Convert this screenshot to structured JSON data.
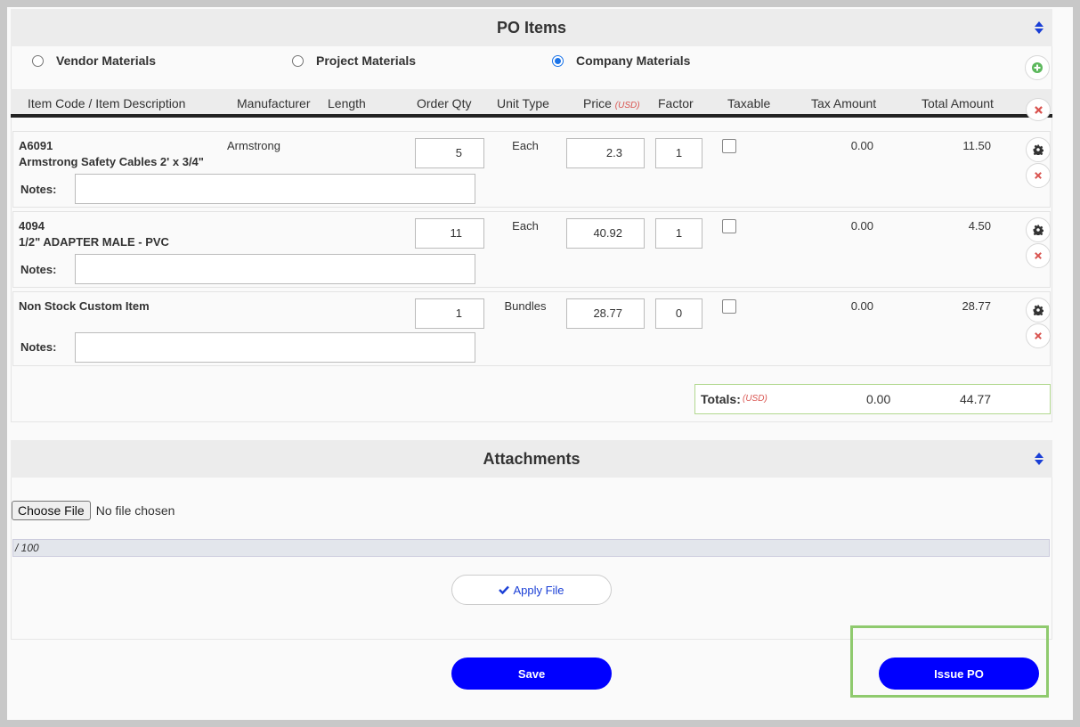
{
  "po_items": {
    "title": "PO Items",
    "radio_options": [
      {
        "label": "Vendor Materials",
        "checked": false
      },
      {
        "label": "Project Materials",
        "checked": false
      },
      {
        "label": "Company Materials",
        "checked": true
      }
    ],
    "columns": {
      "item": "Item Code / Item Description",
      "manufacturer": "Manufacturer",
      "length": "Length",
      "order_qty": "Order Qty",
      "unit_type": "Unit Type",
      "price": "Price",
      "price_currency": "(USD)",
      "factor": "Factor",
      "taxable": "Taxable",
      "tax_amount": "Tax Amount",
      "total_amount": "Total Amount"
    },
    "rows": [
      {
        "code": "A6091",
        "description": "Armstrong Safety Cables 2' x 3/4\"",
        "manufacturer": "Armstrong",
        "qty": "5",
        "unit": "Each",
        "price": "2.3",
        "factor": "1",
        "taxable": false,
        "tax_amount": "0.00",
        "total_amount": "11.50",
        "notes_label": "Notes:",
        "notes": ""
      },
      {
        "code": "4094",
        "description": "1/2\" ADAPTER MALE - PVC",
        "manufacturer": "",
        "qty": "11",
        "unit": "Each",
        "price": "40.92",
        "factor": "1",
        "taxable": false,
        "tax_amount": "0.00",
        "total_amount": "4.50",
        "notes_label": "Notes:",
        "notes": ""
      },
      {
        "code": "",
        "description": "Non Stock Custom Item",
        "manufacturer": "",
        "qty": "1",
        "unit": "Bundles",
        "price": "28.77",
        "factor": "0",
        "taxable": false,
        "tax_amount": "0.00",
        "total_amount": "28.77",
        "notes_label": "Notes:",
        "notes": ""
      }
    ],
    "totals": {
      "label": "Totals:",
      "currency": "(USD)",
      "tax": "0.00",
      "total": "44.77"
    }
  },
  "attachments": {
    "title": "Attachments",
    "choose_file_label": "Choose File",
    "no_file_text": "No file chosen",
    "progress_text": "/ 100",
    "apply_label": "Apply File"
  },
  "actions": {
    "save_label": "Save",
    "issue_label": "Issue PO"
  },
  "colors": {
    "primary": "#0000ff",
    "header_bg": "#ececec",
    "add_icon": "#5cb85c",
    "remove_icon": "#d9534f",
    "highlight": "#8fca6e",
    "currency": "#d9534f"
  }
}
